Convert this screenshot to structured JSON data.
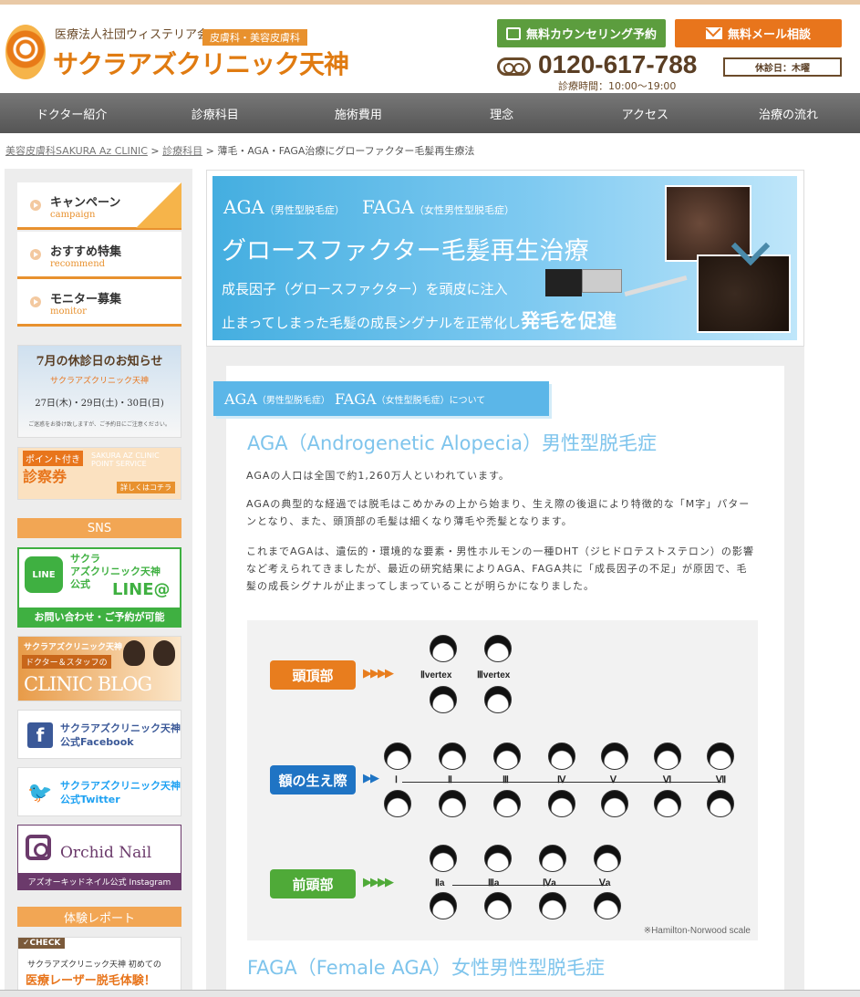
{
  "header": {
    "org": "医療法人社団ウィステリア会",
    "dept": "皮膚科・美容皮膚科",
    "clinic_name": "サクラアズクリニック天神",
    "counsel_btn": "無料カウンセリング予約",
    "mail_btn": "無料メール相談",
    "phone": "0120-617-788",
    "hours": "診療時間：10:00〜19:00",
    "holiday": "休診日：木曜"
  },
  "nav": [
    "ドクター紹介",
    "診療科目",
    "施術費用",
    "理念",
    "アクセス",
    "治療の流れ"
  ],
  "breadcrumb": {
    "home": "美容皮膚科SAKURA Az CLINIC",
    "sep1": " > ",
    "section": "診療科目",
    "sep2": " > ",
    "current": "薄毛・AGA・FAGA治療にグローファクター毛髪再生療法"
  },
  "sidebar": {
    "menu": [
      {
        "jp": "キャンペーン",
        "en": "campaign"
      },
      {
        "jp": "おすすめ特集",
        "en": "recommend"
      },
      {
        "jp": "モニター募集",
        "en": "monitor"
      }
    ],
    "notice": {
      "title": "7月の休診日のお知らせ",
      "sub": "サクラアズクリニック天神",
      "dates": "27日(木)・29日(土)・30日(日)",
      "foot": "ご迷惑をお掛け致しますが、ご予約日にご注意ください。"
    },
    "coupon": {
      "tag": "ポイント付き",
      "title": "診察券",
      "ghost": "SAKURA AZ CLINIC POINT SERVICE",
      "link": "詳しくはコチラ"
    },
    "sns_head": "SNS",
    "line": {
      "logo": "LINE",
      "title1": "サクラ",
      "title2": "アズクリニック天神",
      "title3": "公式",
      "big": "LINE@",
      "bar": "お問い合わせ・ご予約が可能"
    },
    "blog": {
      "title": "サクラアズクリニック天神",
      "sub": "ドクター＆スタッフの",
      "big": "CLINIC BLOG"
    },
    "facebook": {
      "line1": "サクラアズクリニック天神",
      "line2": "公式Facebook"
    },
    "twitter": {
      "line1": "サクラアズクリニック天神",
      "line2": "公式Twitter"
    },
    "orchid": {
      "name": "Orchid Nail",
      "bar": "アズオーキッドネイル公式 Instagram"
    },
    "report_head": "体験レポート",
    "check": {
      "tag": "✓CHECK",
      "line1": "サクラアズクリニック天神 初めての",
      "big": "医療レーザー脱毛体験！"
    }
  },
  "hero": {
    "aga": "AGA",
    "aga_note": "（男性型脱毛症）",
    "faga": "FAGA",
    "faga_note": "（女性男性型脱毛症）",
    "title": "グロースファクター毛髪再生治療",
    "line3": "成長因子（グロースファクター）を頭皮に注入",
    "line4a": "止まってしまった毛髪の成長シグナルを正常化し",
    "line4b": "発毛を促進"
  },
  "section": {
    "tab_aga": "AGA",
    "tab_aga_note": "（男性型脱毛症）",
    "tab_faga": "FAGA",
    "tab_faga_note": "（女性型脱毛症）",
    "tab_suffix": "について",
    "heading": "AGA（Androgenetic Alopecia）男性型脱毛症",
    "p1": "AGAの人口は全国で約1,260万人といわれています。",
    "p2": "AGAの典型的な経過では脱毛はこめかみの上から始まり、生え際の後退により特徴的な「M字」パターンとなり、また、頭頂部の毛髪は細くなり薄毛や禿髪となります。",
    "p3": "これまでAGAは、遺伝的・環境的な要素・男性ホルモンの一種DHT（ジヒドロテストステロン）の影響など考えられてきましたが、最近の研究結果によりAGA、FAGA共に「成長因子の不足」が原因で、毛髪の成長シグナルが止まってしまっていることが明らかになりました。",
    "heading2": "FAGA（Female AGA）女性男性型脱毛症"
  },
  "scale": {
    "label_top": "頭頂部",
    "label_mid": "額の生え際",
    "label_bottom": "前頭部",
    "top_stages": [
      "Ⅱvertex",
      "Ⅲvertex"
    ],
    "mid_stages": [
      "Ⅰ",
      "Ⅱ",
      "Ⅲ",
      "Ⅳ",
      "Ⅴ",
      "Ⅵ",
      "Ⅶ"
    ],
    "bottom_stages": [
      "Ⅱa",
      "Ⅲa",
      "Ⅳa",
      "Ⅴa"
    ],
    "credit": "※Hamilton-Norwood scale"
  }
}
